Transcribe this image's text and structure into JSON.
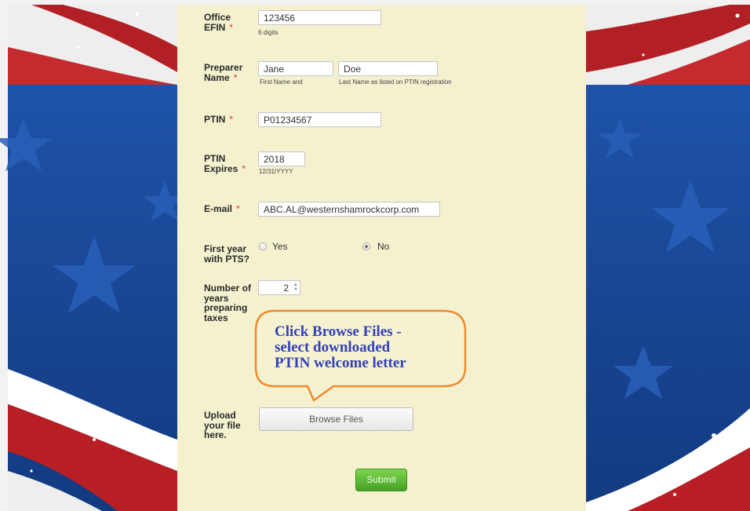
{
  "form": {
    "office_efin": {
      "label_line1": "Office",
      "label_line2": "EFIN",
      "required": "*",
      "value": "123456",
      "hint": "6 digits"
    },
    "preparer_name": {
      "label_line1": "Preparer",
      "label_line2": "Name",
      "required": "*",
      "first_value": "Jane",
      "first_hint": "First Name and",
      "last_value": "Doe",
      "last_hint": "Last Name as listed on PTIN registration"
    },
    "ptin": {
      "label": "PTIN",
      "required": "*",
      "value": "P01234567"
    },
    "ptin_expires": {
      "label_line1": "PTIN",
      "label_line2": "Expires",
      "required": "*",
      "value": "2018",
      "hint": "12/31/YYYY"
    },
    "email": {
      "label": "E-mail",
      "required": "*",
      "value": "ABC.AL@westernshamrockcorp.com"
    },
    "first_year": {
      "label_line1": "First year",
      "label_line2": "with PTS?",
      "options": [
        "Yes",
        "No"
      ],
      "selected": "No"
    },
    "years_preparing": {
      "label_lines": [
        "Number of",
        "years",
        "preparing",
        "taxes"
      ],
      "value": "2"
    },
    "upload": {
      "label_lines": [
        "Upload",
        "your file",
        "here."
      ],
      "button_label": "Browse Files"
    },
    "submit_label": "Submit"
  },
  "callout": {
    "lines": [
      "Click Browse Files -",
      "select downloaded",
      "PTIN welcome letter"
    ],
    "border_color": "#f08a30",
    "text_color": "#3540b8"
  },
  "colors": {
    "panel": "#f4f1cf",
    "blue": "#1a4a9a",
    "red": "#a81c1c",
    "submit": "#5cb531"
  }
}
